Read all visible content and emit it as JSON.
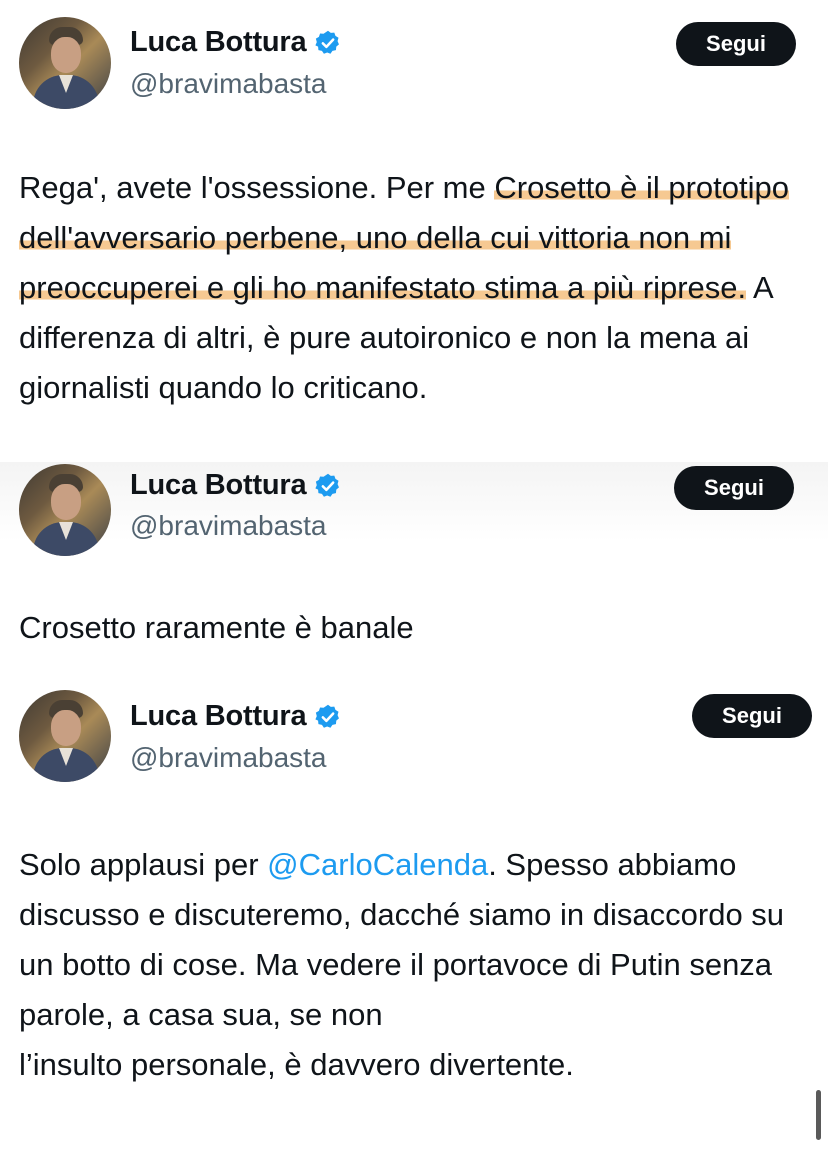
{
  "tweets": [
    {
      "author": {
        "name": "Luca Bottura",
        "handle": "@bravimabasta"
      },
      "follow_label": "Segui",
      "text_before": "Rega', avete l'ossessione. Per me ",
      "text_highlight": "Crosetto è il prototipo dell'avversario perbene, uno della cui vittoria non mi preoccuperei e gli ho manifestato stima a più riprese.",
      "text_after": " A differenza di altri, è pure autoironico e non la mena ai giornalisti quando lo criticano."
    },
    {
      "author": {
        "name": "Luca Bottura",
        "handle": "@bravimabasta"
      },
      "follow_label": "Segui",
      "text": "Crosetto raramente è banale"
    },
    {
      "author": {
        "name": "Luca Bottura",
        "handle": "@bravimabasta"
      },
      "follow_label": "Segui",
      "text_before": "Solo applausi per ",
      "mention": "@CarloCalenda",
      "text_after": ". Spesso abbiamo discusso e discuteremo, dacché siamo in disaccordo su un botto di cose. Ma vedere il portavoce di Putin senza parole, a casa sua, se non\nl’insulto personale, è davvero divertente."
    }
  ],
  "colors": {
    "highlight": "#f6c992",
    "mention": "#1d9bf0",
    "verified_badge": "#1d9bf0",
    "follow_button": "#0f1419"
  },
  "icons": [
    "verified-badge-icon",
    "avatar"
  ]
}
